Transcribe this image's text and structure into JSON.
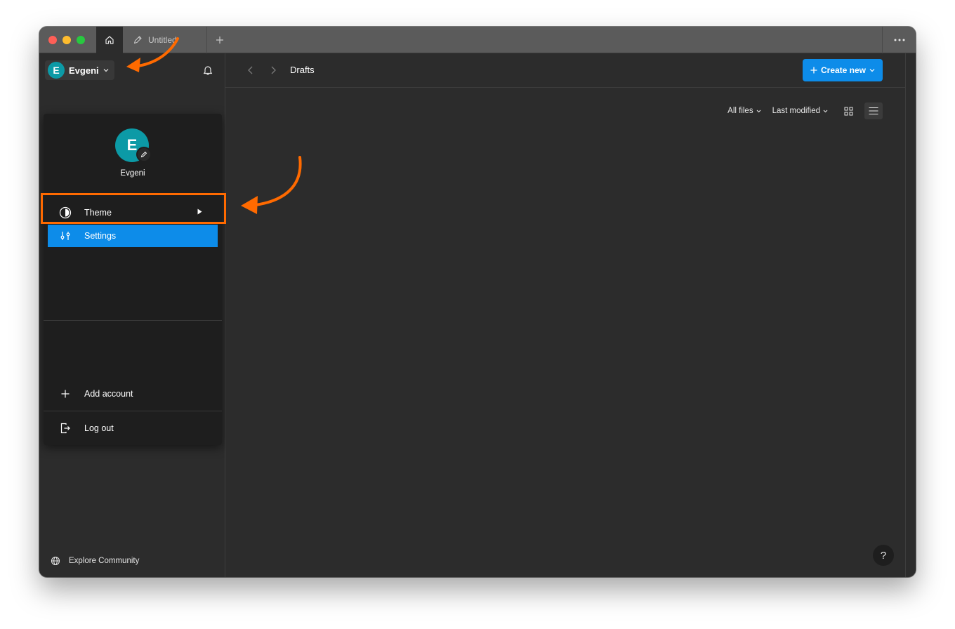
{
  "titlebar": {
    "file_tab_label": "Untitled",
    "icons": {
      "home": "home-icon",
      "file": "pen-file-icon",
      "new_tab": "plus-icon",
      "more": "more-horizontal-icon"
    }
  },
  "sidebar": {
    "account_name": "Evgeni",
    "avatar_initial": "E",
    "avatar_color": "#0c9aa6",
    "explore_label": "Explore Community"
  },
  "dropdown": {
    "avatar_initial": "E",
    "user_name": "Evgeni",
    "items": [
      {
        "label": "Theme",
        "icon": "contrast-icon",
        "submenu": true
      },
      {
        "label": "Settings",
        "icon": "sliders-icon",
        "highlighted": true
      },
      {
        "label": "Add account",
        "icon": "plus-icon"
      },
      {
        "label": "Log out",
        "icon": "logout-icon"
      }
    ]
  },
  "main": {
    "page_title": "Drafts",
    "create_label": "Create new",
    "filter_files": "All files",
    "sort_label": "Last modified",
    "help_label": "?"
  },
  "colors": {
    "accent": "#0d8ce9",
    "annotation": "#ff6a00",
    "background": "#2c2c2c",
    "menu": "#1e1e1e"
  }
}
